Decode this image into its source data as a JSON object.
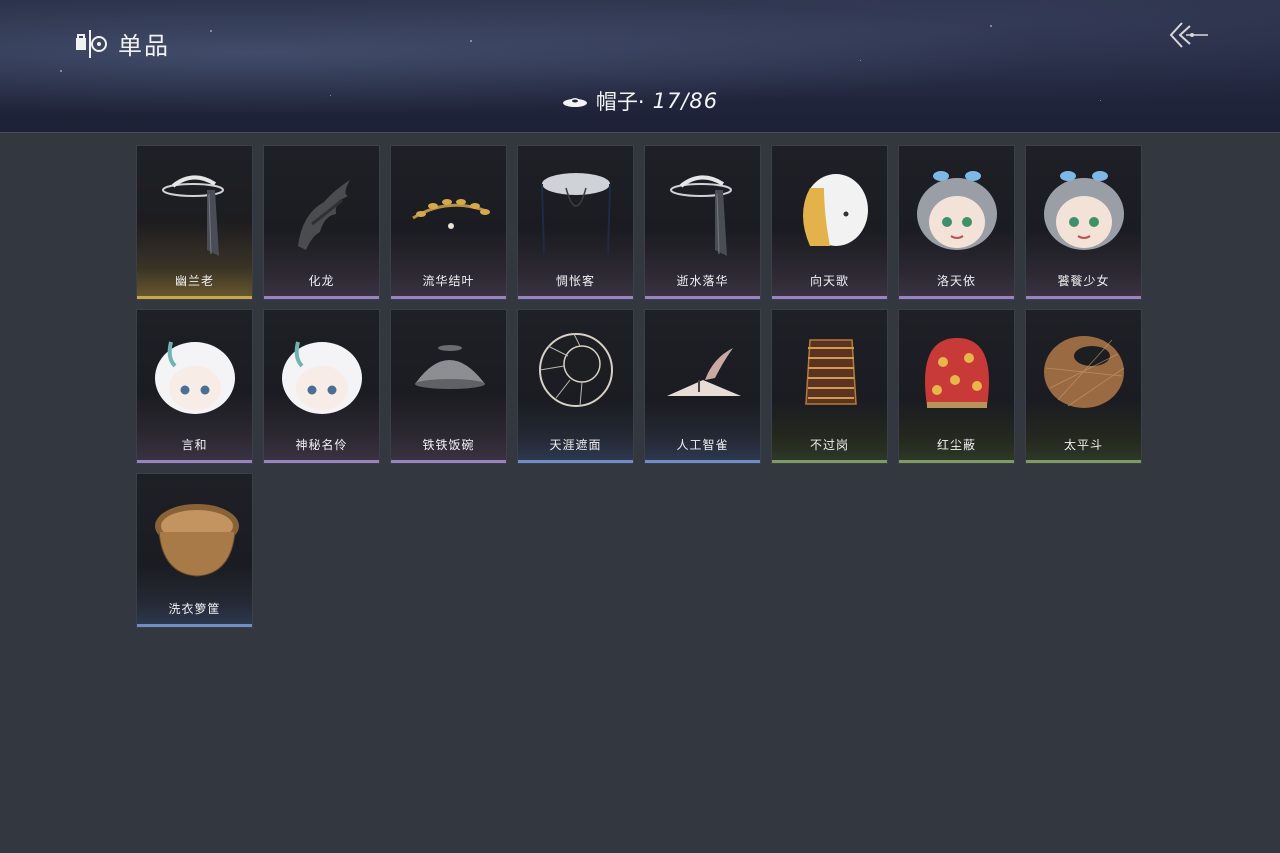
{
  "header": {
    "title": "单品",
    "category_label": "帽子·",
    "count": "17/86",
    "logo_icon": "wardrobe-icon",
    "back_icon": "back-arrow-icon"
  },
  "items": [
    {
      "name": "幽兰老",
      "rarity": "gold",
      "icon": "veiled-headpiece-icon"
    },
    {
      "name": "化龙",
      "rarity": "purple",
      "icon": "dragon-crown-icon"
    },
    {
      "name": "流华结叶",
      "rarity": "purple",
      "icon": "laurel-wreath-icon"
    },
    {
      "name": "惆怅客",
      "rarity": "purple",
      "icon": "veiled-bamboo-hat-icon"
    },
    {
      "name": "逝水落华",
      "rarity": "purple",
      "icon": "veiled-headpiece-icon"
    },
    {
      "name": "向天歌",
      "rarity": "purple",
      "icon": "goose-hat-icon"
    },
    {
      "name": "洛天依",
      "rarity": "purple",
      "icon": "chibi-head-icon"
    },
    {
      "name": "饕餮少女",
      "rarity": "purple",
      "icon": "chibi-head-icon"
    },
    {
      "name": "言和",
      "rarity": "purple",
      "icon": "chibi-head-white-icon"
    },
    {
      "name": "神秘名伶",
      "rarity": "purple",
      "icon": "chibi-head-white-icon"
    },
    {
      "name": "铁铁饭碗",
      "rarity": "purple",
      "icon": "iron-bowl-icon"
    },
    {
      "name": "天涯遮面",
      "rarity": "blue",
      "icon": "frame-hat-icon"
    },
    {
      "name": "人工智雀",
      "rarity": "blue",
      "icon": "bird-hat-icon"
    },
    {
      "name": "不过岗",
      "rarity": "green",
      "icon": "stacked-bowls-icon"
    },
    {
      "name": "红尘蔽",
      "rarity": "green",
      "icon": "red-hood-icon"
    },
    {
      "name": "太平斗",
      "rarity": "green",
      "icon": "woven-hat-icon"
    },
    {
      "name": "洗衣箩筐",
      "rarity": "blue",
      "icon": "laundry-basket-icon"
    }
  ]
}
